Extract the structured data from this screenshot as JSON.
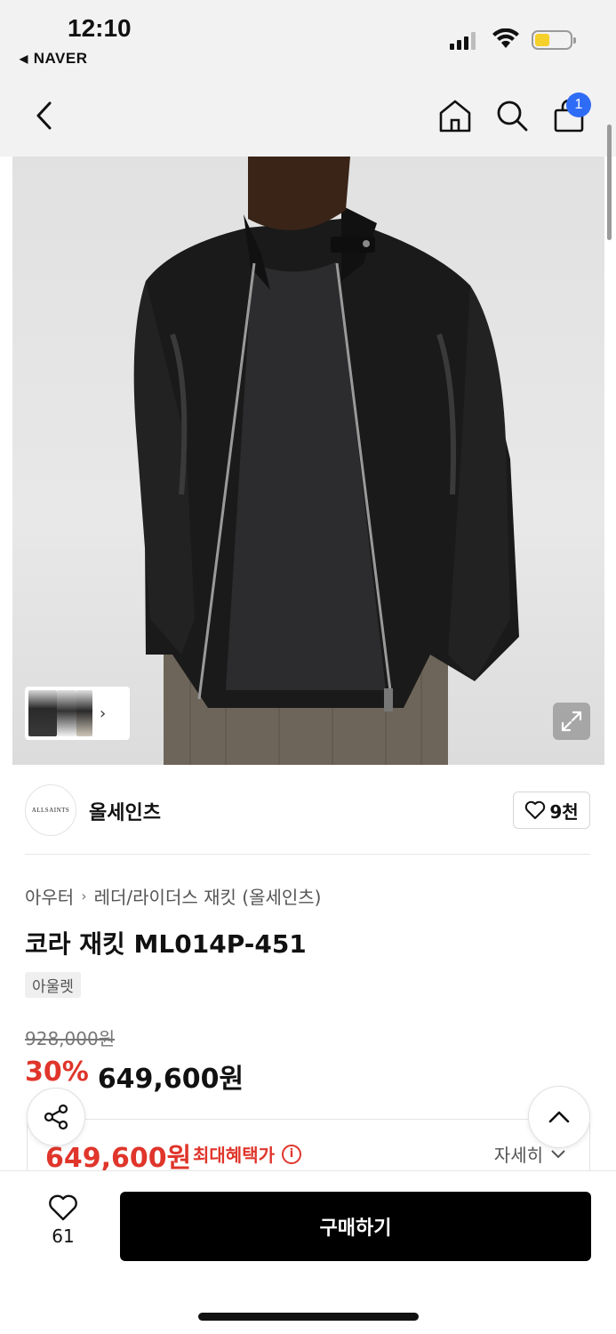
{
  "status_bar": {
    "time": "12:10",
    "back_app": "NAVER"
  },
  "header": {
    "cart_count": "1"
  },
  "product_image": {
    "expand_icon": "expand-icon"
  },
  "brand": {
    "logo_text": "ALLSAINTS",
    "name": "올세인츠",
    "likes": "9천"
  },
  "product": {
    "category_parent": "아우터",
    "category_child": "레더/라이더스 재킷 (올세인츠)",
    "title": "코라 재킷 ML014P-451",
    "tag": "아울렛",
    "original_price": "928,000원",
    "discount": "30%",
    "sale_price": "649,600원"
  },
  "benefit": {
    "price": "649,600원",
    "label": "최대혜택가",
    "detail": "자세히"
  },
  "bottom_bar": {
    "wish_count": "61",
    "buy_label": "구매하기"
  },
  "colors": {
    "accent_red": "#e0352b",
    "badge_blue": "#2f6cf6",
    "buy_button": "#000000"
  }
}
